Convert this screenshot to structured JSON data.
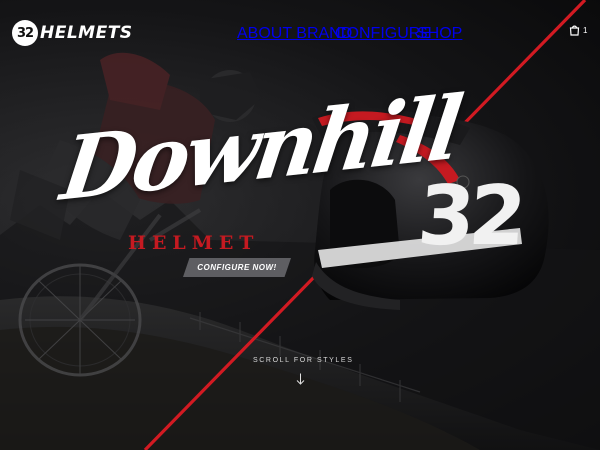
{
  "header": {
    "logo_badge": "32",
    "logo_text": "HELMETS",
    "nav": [
      "ABOUT BRAND",
      "CONFIGURE",
      "SHOP"
    ],
    "cart_count": "1"
  },
  "hero": {
    "script_title": "Downhill",
    "subtitle": "HELMET",
    "cta_label": "CONFIGURE NOW!",
    "helmet_number": "32",
    "scroll_label": "SCROLL FOR STYLES"
  },
  "colors": {
    "accent": "#c51a21",
    "background": "#0b0b0c",
    "cta_bg": "#5e5e62"
  },
  "icons": [
    "cart-icon",
    "arrow-down-icon"
  ]
}
